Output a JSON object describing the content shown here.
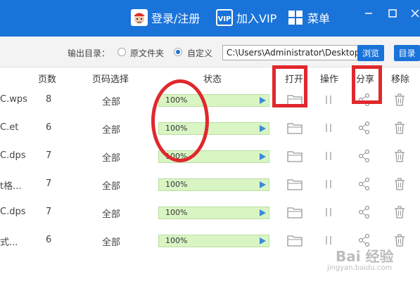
{
  "titlebar": {
    "login_label": "登录/注册",
    "vip_label": "加入VIP",
    "menu_label": "菜单",
    "vip_badge": "VIP",
    "bg_color": "#1a73d9"
  },
  "output": {
    "label": "输出目录：",
    "option_original": "原文件夹",
    "option_custom": "自定义",
    "selected": "自定义",
    "path_value": "C:\\Users\\Administrator\\Desktop",
    "browse_label": "浏览",
    "dir_label": "目录"
  },
  "table": {
    "headers": {
      "pages": "页数",
      "page_select": "页码选择",
      "status": "状态",
      "open": "打开",
      "operate": "操作",
      "share": "分享",
      "remove": "移除"
    },
    "rows": [
      {
        "name": "C.wps",
        "pages": "8",
        "page_select": "全部",
        "progress": "100%",
        "progress_value": 1.0
      },
      {
        "name": "C.et",
        "pages": "6",
        "page_select": "全部",
        "progress": "100%",
        "progress_value": 1.0
      },
      {
        "name": "C.dps",
        "pages": "7",
        "page_select": "全部",
        "progress": "100%",
        "progress_value": 1.0
      },
      {
        "name": "t格...",
        "pages": "7",
        "page_select": "全部",
        "progress": "100%",
        "progress_value": 1.0
      },
      {
        "name": "C.dps",
        "pages": "7",
        "page_select": "全部",
        "progress": "100%",
        "progress_value": 1.0
      },
      {
        "name": "式...",
        "pages": "6",
        "page_select": "全部",
        "progress": "100%",
        "progress_value": 1.0
      }
    ]
  },
  "icons": {
    "open": "folder-icon",
    "operate": "pause-icon",
    "share": "share-icon",
    "remove": "trash-icon"
  },
  "watermark": {
    "main": "Bai 经验",
    "sub": "jingyan.baidu.com"
  },
  "annotation_color": "#e0282c"
}
